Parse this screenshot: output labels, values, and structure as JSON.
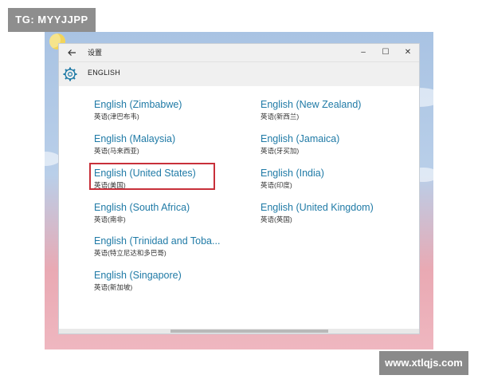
{
  "watermarks": {
    "top": "TG: MYYJJPP",
    "bottom": "www.xtlqjs.com"
  },
  "window": {
    "title": "设置",
    "controls": {
      "minimize": "–",
      "maximize": "☐",
      "close": "✕"
    },
    "back_icon": "arrow-left",
    "header": {
      "icon": "gear-icon",
      "title": "ENGLISH"
    }
  },
  "languages": [
    {
      "name": "English (Zimbabwe)",
      "sub": "英语(津巴布韦)"
    },
    {
      "name": "English (New Zealand)",
      "sub": "英语(新西兰)"
    },
    {
      "name": "English (Malaysia)",
      "sub": "英语(马来西亚)"
    },
    {
      "name": "English (Jamaica)",
      "sub": "英语(牙买加)"
    },
    {
      "name": "English (United States)",
      "sub": "英语(美国)",
      "selected": true
    },
    {
      "name": "English (India)",
      "sub": "英语(印度)"
    },
    {
      "name": "English (South Africa)",
      "sub": "英语(南非)"
    },
    {
      "name": "English (United Kingdom)",
      "sub": "英语(英国)"
    },
    {
      "name": "English (Trinidad and Toba...",
      "sub": "英语(特立尼达和多巴哥)"
    },
    {
      "name": "English (Singapore)",
      "sub": "英语(新加坡)"
    }
  ],
  "colors": {
    "link": "#1f7aa6",
    "selection_border": "#c8303a",
    "titlebar": "#f0f0f0"
  }
}
